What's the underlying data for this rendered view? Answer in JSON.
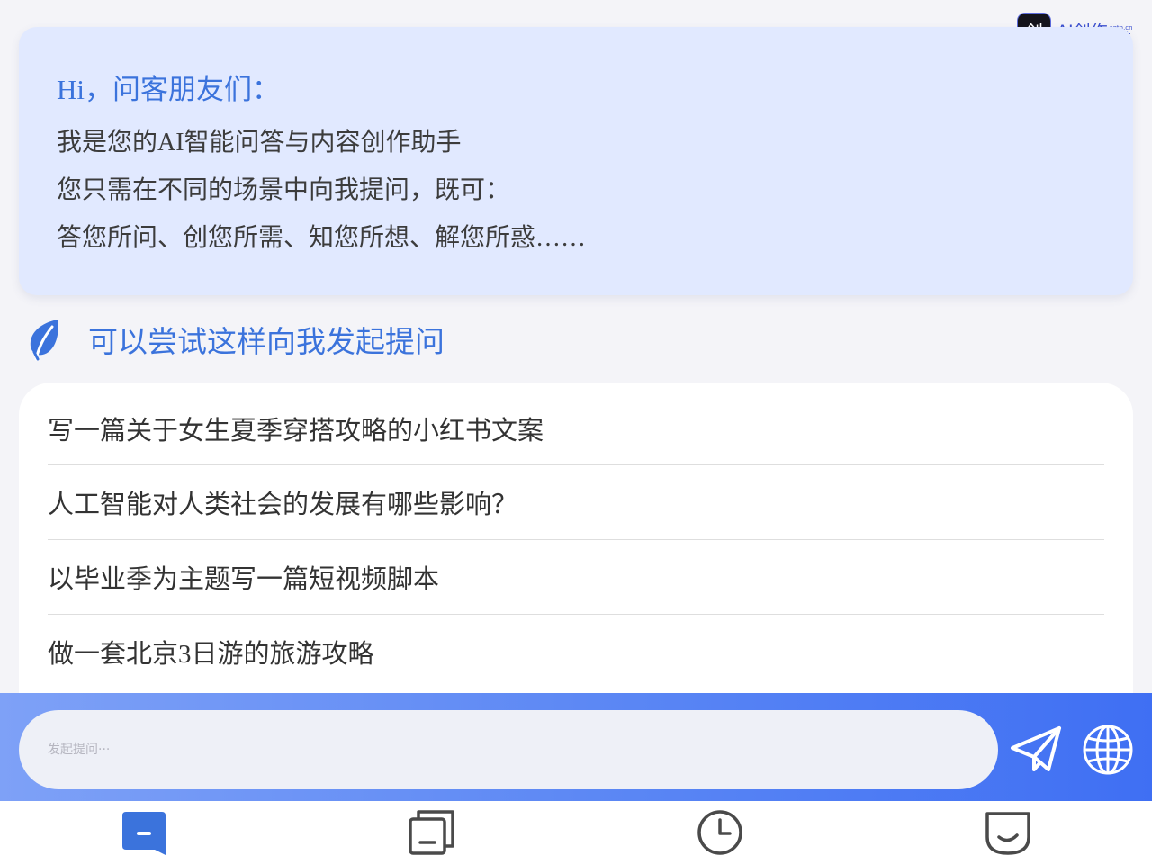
{
  "logo": {
    "mark": "创",
    "main": "AI创作",
    "domain": "cgtn.cn",
    "nav": "导航"
  },
  "welcome": {
    "greeting": "Hi，问客朋友们：",
    "lines": [
      "我是您的AI智能问答与内容创作助手",
      "您只需在不同的场景中向我提问，既可：",
      "答您所问、创您所需、知您所想、解您所惑……"
    ]
  },
  "suggestions": {
    "title": "可以尝试这样向我发起提问",
    "title_icon": "leaf-icon",
    "items": [
      "写一篇关于女生夏季穿搭攻略的小红书文案",
      "人工智能对人类社会的发展有哪些影响？",
      "以毕业季为主题写一篇短视频脚本",
      "做一套北京3日游的旅游攻略"
    ]
  },
  "input": {
    "placeholder": "发起提问···",
    "value": ""
  },
  "icons": {
    "send": "send-icon",
    "globe": "globe-icon"
  },
  "tabs": [
    {
      "name": "chat",
      "icon": "chat-icon",
      "active": true
    },
    {
      "name": "templates",
      "icon": "cards-icon",
      "active": false
    },
    {
      "name": "history",
      "icon": "clock-icon",
      "active": false
    },
    {
      "name": "profile",
      "icon": "smile-icon",
      "active": false
    }
  ],
  "colors": {
    "accent": "#3b73dc",
    "card_bg": "#e1e9ff",
    "bar_start": "#7ea1f7",
    "bar_end": "#3f6ff3",
    "icon_gray": "#4a4a4a"
  }
}
